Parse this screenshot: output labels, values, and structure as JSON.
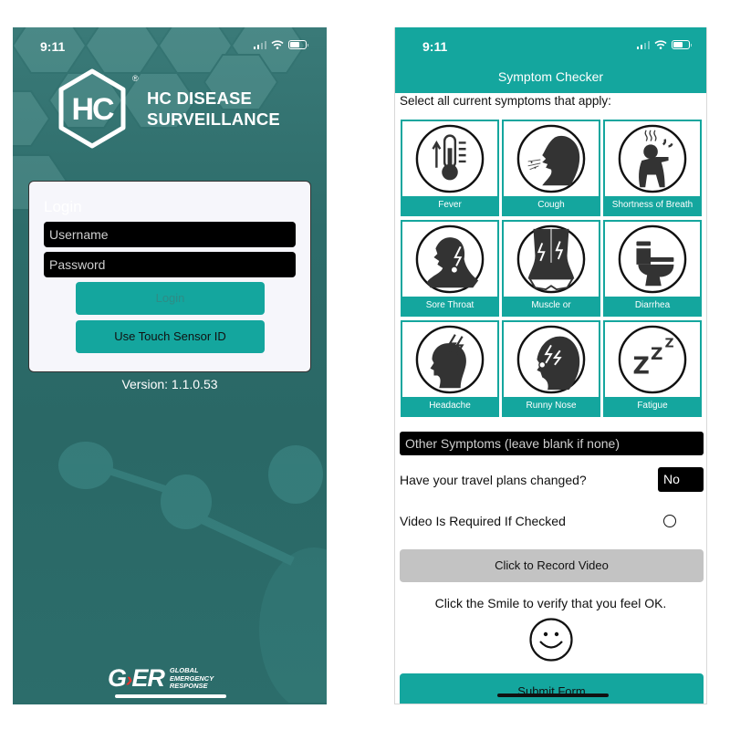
{
  "login_screen": {
    "status_bar": {
      "time": "9:11"
    },
    "app_name_line1": "HC DISEASE",
    "app_name_line2": "SURVEILLANCE",
    "logo_text": "HC",
    "logo_registered": "®",
    "login_heading": "Login",
    "username_placeholder": "Username",
    "password_placeholder": "Password",
    "login_button": "Login",
    "touch_button": "Use Touch Sensor ID",
    "version": "Version: 1.1.0.53",
    "footer_brand": {
      "mark_g": "G",
      "mark_k": "›",
      "mark_er": "ER",
      "line1": "GLOBAL",
      "line2": "EMERGENCY",
      "line3": "RESPONSE"
    }
  },
  "symptom_screen": {
    "status_bar": {
      "time": "9:11"
    },
    "title": "Symptom Checker",
    "instructions": "Select all current symptoms that apply:",
    "symptoms": [
      {
        "label": "Fever",
        "icon": "thermometer-icon"
      },
      {
        "label": "Cough",
        "icon": "cough-icon"
      },
      {
        "label": "Shortness of Breath",
        "icon": "breathless-icon"
      },
      {
        "label": "Sore Throat",
        "icon": "sore-throat-icon"
      },
      {
        "label": "Muscle or",
        "icon": "muscle-pain-icon"
      },
      {
        "label": "Diarrhea",
        "icon": "toilet-icon"
      },
      {
        "label": "Headache",
        "icon": "headache-icon"
      },
      {
        "label": "Runny Nose",
        "icon": "runny-nose-icon"
      },
      {
        "label": "Fatigue",
        "icon": "zzz-icon"
      }
    ],
    "other_symptoms_placeholder": "Other Symptoms (leave blank if none)",
    "travel_label": "Have your travel plans changed?",
    "travel_value": "No",
    "video_label": "Video Is Required If Checked",
    "video_checked": false,
    "record_button": "Click to Record Video",
    "smile_instruction": "Click the Smile to verify that you feel OK.",
    "submit_button": "Submit Form"
  },
  "colors": {
    "teal": "#14a69e",
    "login_bg": "#2d6c6a",
    "record_button_bg": "#c3c3c3",
    "brand_red": "#e5322d"
  }
}
